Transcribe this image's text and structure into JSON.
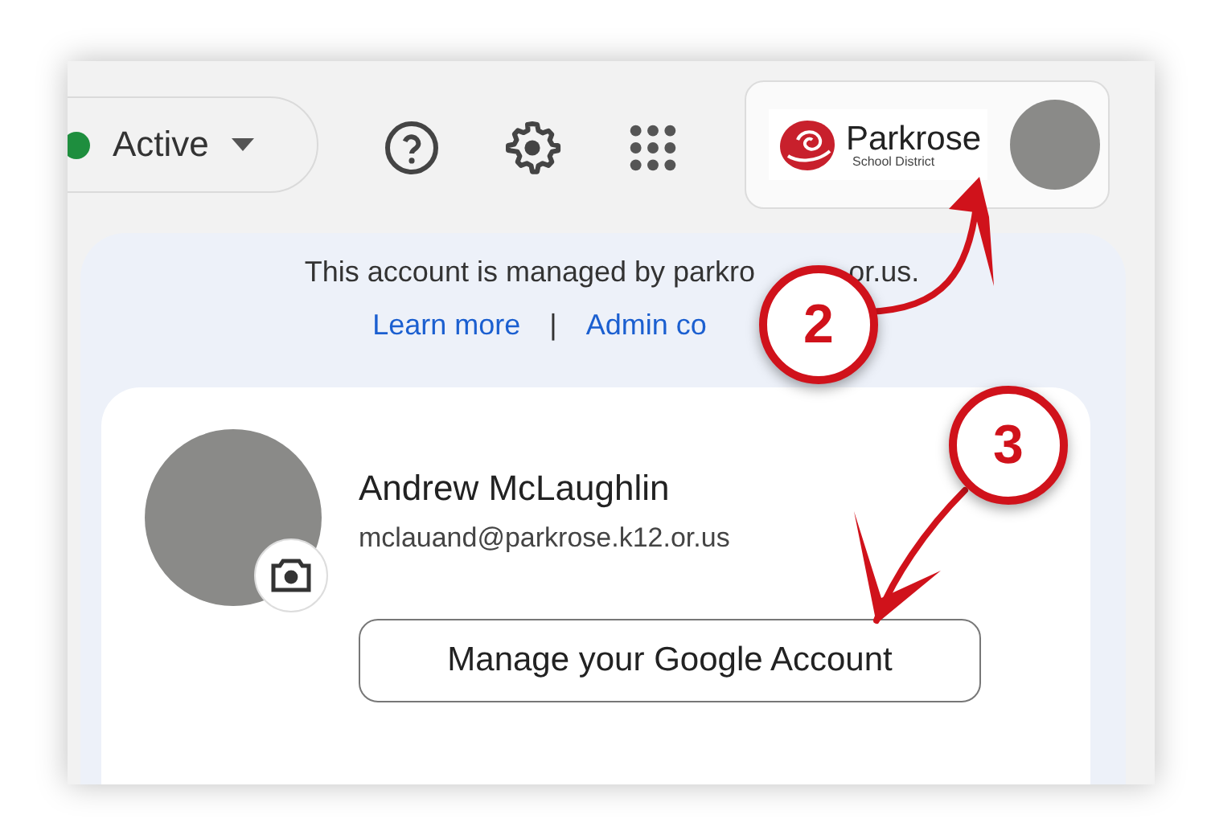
{
  "status": {
    "label": "Active"
  },
  "account_chip": {
    "org_name": "Parkrose",
    "org_subtitle": "School District"
  },
  "account_menu": {
    "notice_start": "This account is managed by parkro",
    "notice_end": "or.us.",
    "links": [
      "Learn more",
      "Admin co"
    ],
    "separator": "|",
    "user": {
      "name": "Andrew McLaughlin",
      "email": "mclauand@parkrose.k12.or.us"
    },
    "manage_button": "Manage your Google Account"
  },
  "annotations": [
    {
      "number": "2"
    },
    {
      "number": "3"
    }
  ]
}
